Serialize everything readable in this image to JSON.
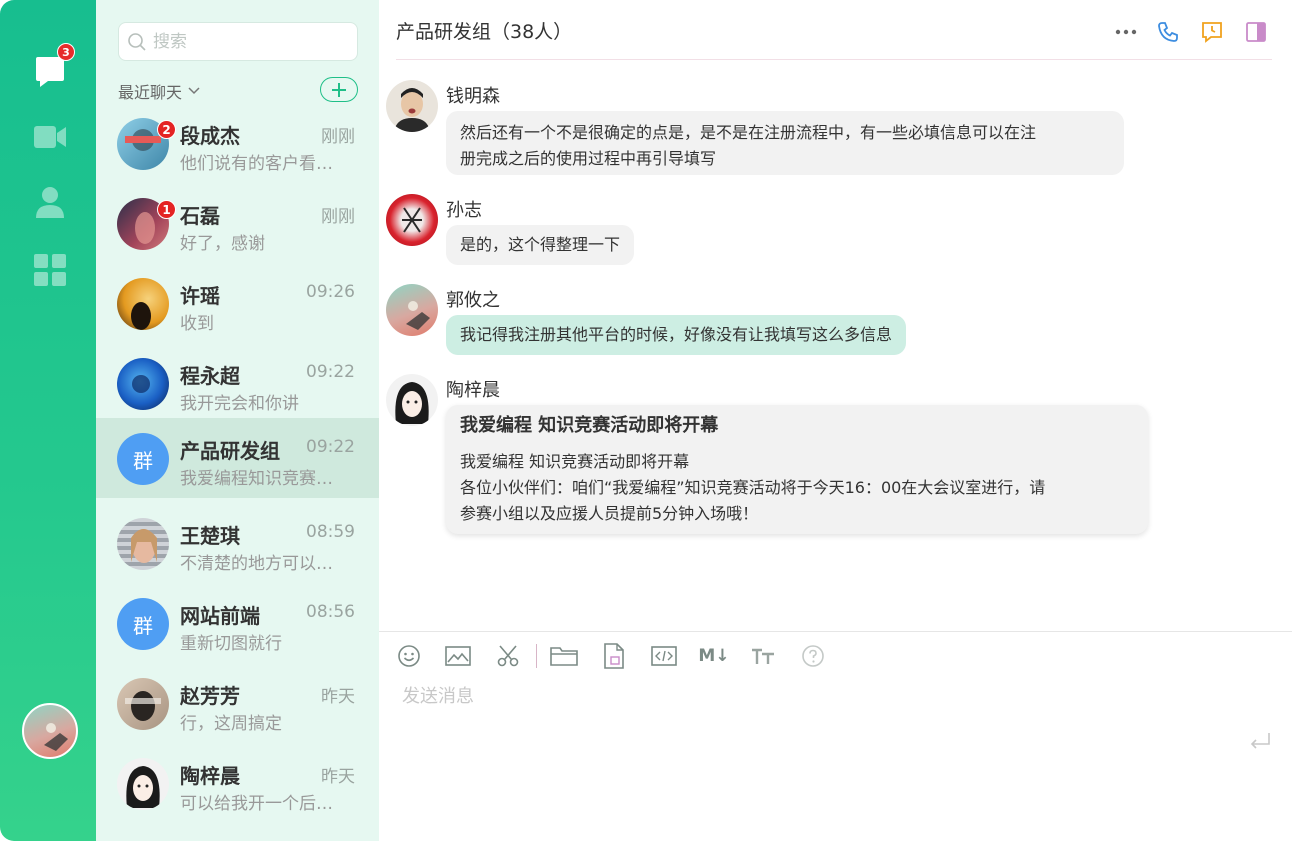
{
  "rail": {
    "chat_badge": "3"
  },
  "search": {
    "placeholder": "搜索"
  },
  "list": {
    "recent_label": "最近聊天"
  },
  "conversations": [
    {
      "name": "段成杰",
      "time": "刚刚",
      "preview": "他们说有的客户看…",
      "badge": "2"
    },
    {
      "name": "石磊",
      "time": "刚刚",
      "preview": "好了，感谢",
      "badge": "1"
    },
    {
      "name": "许瑶",
      "time": "09:26",
      "preview": "收到"
    },
    {
      "name": "程永超",
      "time": "09:22",
      "preview": "我开完会和你讲"
    },
    {
      "name": "产品研发组",
      "time": "09:22",
      "preview": "我爱编程知识竞赛…",
      "avatar_text": "群"
    },
    {
      "name": "王楚琪",
      "time": "08:59",
      "preview": "不清楚的地方可以…"
    },
    {
      "name": "网站前端",
      "time": "08:56",
      "preview": "重新切图就行",
      "avatar_text": "群"
    },
    {
      "name": "赵芳芳",
      "time": "昨天",
      "preview": "行，这周搞定"
    },
    {
      "name": "陶梓晨",
      "time": "昨天",
      "preview": "可以给我开一个后…"
    }
  ],
  "chat": {
    "title": "产品研发组（38人）",
    "messages": [
      {
        "sender": "钱明森",
        "text_line1": "然后还有一个不是很确定的点是，是不是在注册流程中，有一些必填信息可以在注",
        "text_line2": "册完成之后的使用过程中再引导填写"
      },
      {
        "sender": "孙志",
        "text": "是的，这个得整理一下"
      },
      {
        "sender": "郭攸之",
        "text": "我记得我注册其他平台的时候，好像没有让我填写这么多信息"
      },
      {
        "sender": "陶梓晨",
        "card_title": "我爱编程 知识竞赛活动即将开幕",
        "card_line1": "我爱编程 知识竞赛活动即将开幕",
        "card_line2": "各位小伙伴们：咱们“我爱编程”知识竞赛活动将于今天16：00在大会议室进行，请",
        "card_line3": "参赛小组以及应援人员提前5分钟入场哦！"
      }
    ]
  },
  "composer": {
    "placeholder": "发送消息",
    "markdown_label": "M↓"
  },
  "colors": {
    "rail_top": "#17be8f",
    "list_bg": "#e6f8f1",
    "active_row": "#cfe9dd",
    "mint_bubble": "#cdeee3",
    "badge": "#e42424",
    "group_avatar": "#4f9ef3"
  }
}
